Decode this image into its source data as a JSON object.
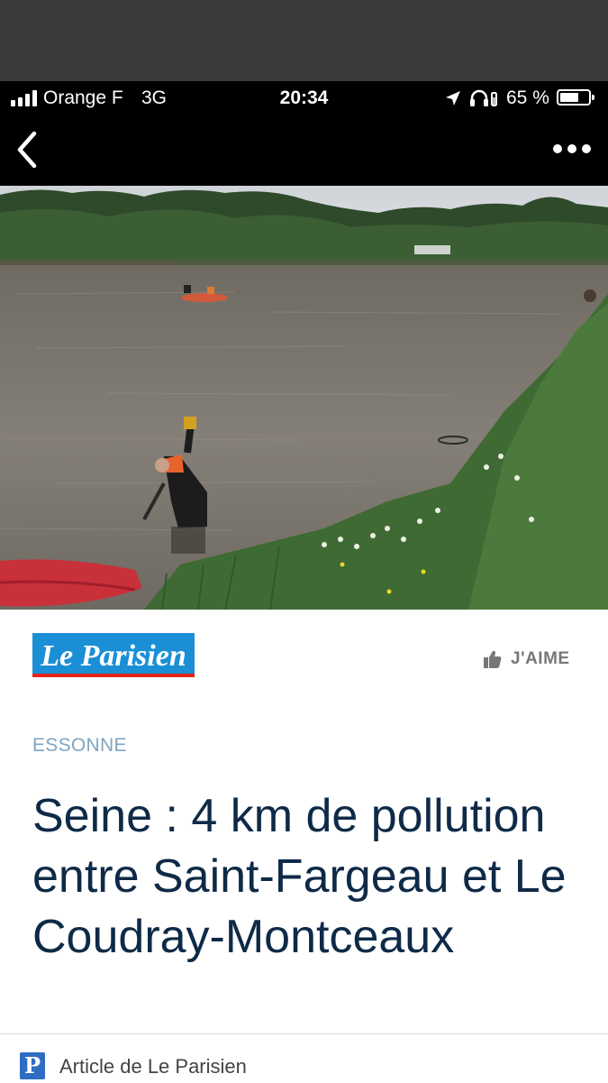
{
  "status_bar": {
    "carrier": "Orange F",
    "network": "3G",
    "time": "20:34",
    "battery": "65 %",
    "battery_level": 0.65
  },
  "nav": {
    "back_icon": "chevron-left-icon",
    "more_icon": "ellipsis-icon"
  },
  "article": {
    "brand": {
      "logo_text": "Le Parisien",
      "logo_color": "#1a8fd6",
      "logo_underline_color": "#e2231a"
    },
    "like_label": "J'AIME",
    "section": "ESSONNE",
    "headline": "Seine : 4 km de pollution entre Saint-Fargeau et Le Coudray-Montceaux"
  },
  "footer": {
    "logo_letter": "P",
    "label": "Article de Le Parisien"
  },
  "colors": {
    "headline": "#0e2a47",
    "section": "#7fa5c2",
    "top_bar": "#3a3a3a"
  }
}
